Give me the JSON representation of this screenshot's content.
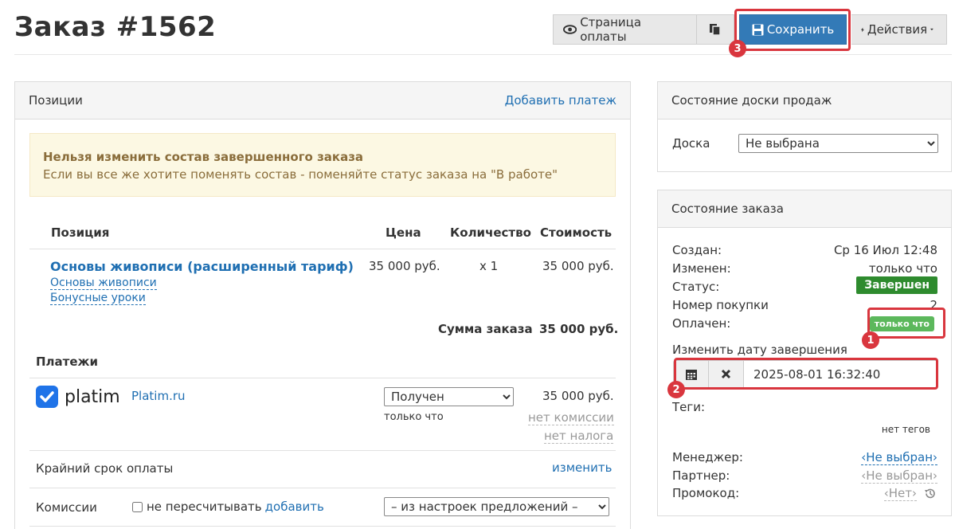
{
  "header": {
    "title": "Заказ #1562",
    "payment_page_label": "Страница оплаты",
    "save_label": "Сохранить",
    "actions_label": "Действия"
  },
  "callouts": [
    "1",
    "2",
    "3"
  ],
  "positions_panel": {
    "title": "Позиции",
    "add_payment_link": "Добавить платеж",
    "alert_title": "Нельзя изменить состав завершенного заказа",
    "alert_text": "Если вы все же хотите поменять состав - поменяйте статус заказа на \"В работе\"",
    "columns": {
      "item": "Позиция",
      "price": "Цена",
      "qty": "Количество",
      "cost": "Стоимость"
    },
    "item": {
      "name": "Основы живописи (расширенный тариф)",
      "sub1": "Основы живописи",
      "sub2": "Бонусные уроки",
      "price": "35 000 руб.",
      "qty": "x 1",
      "cost": "35 000 руб."
    },
    "total_label": "Сумма заказа",
    "total_value": "35 000 руб.",
    "payments_title": "Платежи",
    "payment": {
      "logo_text": "platim",
      "name": "Platim.ru",
      "status": "Получен",
      "status_time": "только что",
      "amount": "35 000 руб.",
      "no_commission": "нет комиссии",
      "no_tax": "нет налога"
    },
    "deadline_label": "Крайний срок оплаты",
    "deadline_change": "изменить",
    "commissions_label": "Комиссии",
    "no_recalc_label": "не пересчитывать",
    "add_link": "добавить",
    "commission_select": "– из настроек предложений –"
  },
  "board_panel": {
    "title": "Состояние доски продаж",
    "board_label": "Доска",
    "board_value": "Не выбрана"
  },
  "order_state_panel": {
    "title": "Состояние заказа",
    "created_label": "Создан:",
    "created_value": "Ср 16 Июл 12:48",
    "modified_label": "Изменен:",
    "modified_value": "только что",
    "status_label": "Статус:",
    "status_value": "Завершен",
    "purchase_label": "Номер покупки",
    "purchase_value": "2",
    "paid_label": "Оплачен:",
    "paid_value": "только что",
    "change_date_label": "Изменить дату завершения",
    "date_value": "2025-08-01 16:32:40",
    "tags_label": "Теги:",
    "no_tags": "нет тегов",
    "manager_label": "Менеджер:",
    "manager_value": "‹Не выбран›",
    "partner_label": "Партнер:",
    "partner_value": "‹Не выбран›",
    "promo_label": "Промокод:",
    "promo_value": "‹Нет›"
  }
}
